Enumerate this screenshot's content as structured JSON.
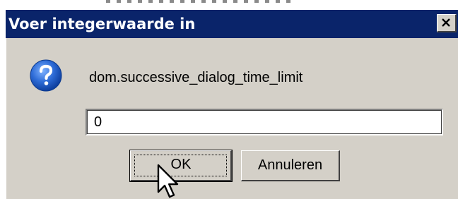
{
  "dialog": {
    "title": "Voer integerwaarde in",
    "close_glyph": "×",
    "icon": "question-icon",
    "prompt": "dom.successive_dialog_time_limit",
    "input_value": "0",
    "ok_label": "OK",
    "cancel_label": "Annuleren"
  },
  "colors": {
    "titlebar": "#0a246a",
    "dialog_bg": "#d4d0c8",
    "icon_blue": "#2d6bd6"
  }
}
